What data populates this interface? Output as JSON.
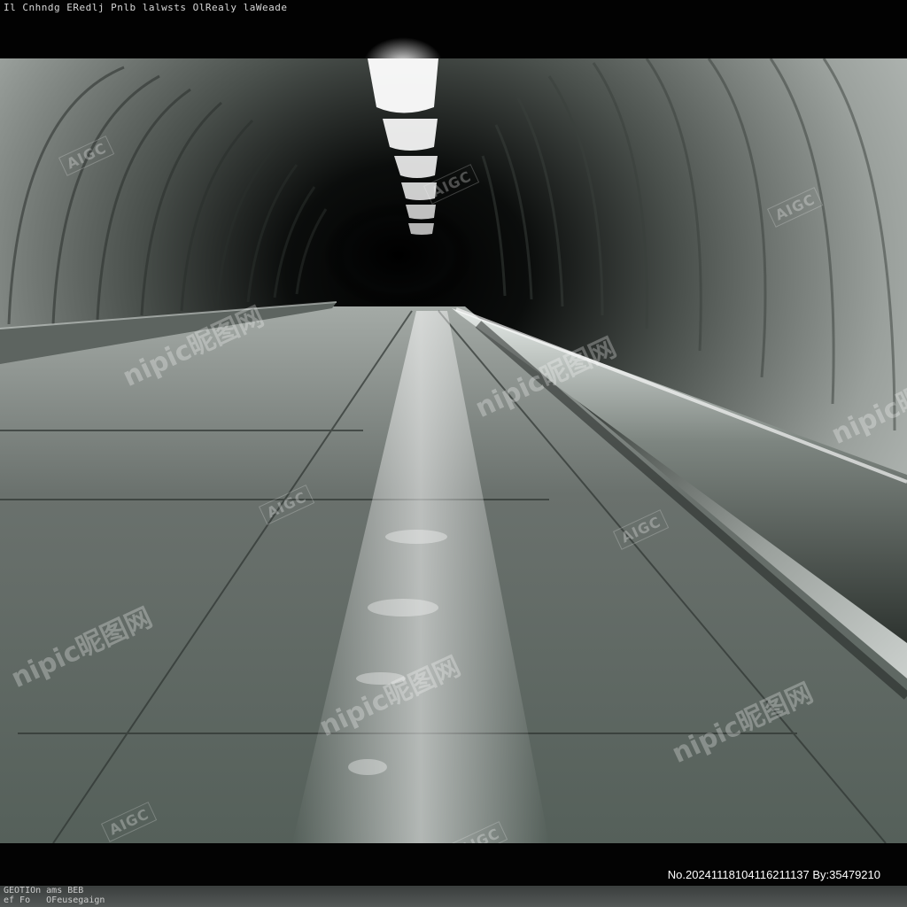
{
  "header": {
    "caption": "Il Cnhndg  ERedlj  Pnlb  lalwsts  OlRealy  laWeade"
  },
  "footer": {
    "image_id": "No.20241118104116211137 By:35479210",
    "caption": "GEOTIOn ams BEB\nef Fo   OFeusegaign"
  },
  "watermarks": {
    "aigc": "AIGC",
    "nipic": "nipic昵图网"
  },
  "colors": {
    "frame": "#000000",
    "tunnel_wall": "#9aa09c",
    "tunnel_floor": "#7d8480",
    "light": "#ffffff"
  }
}
